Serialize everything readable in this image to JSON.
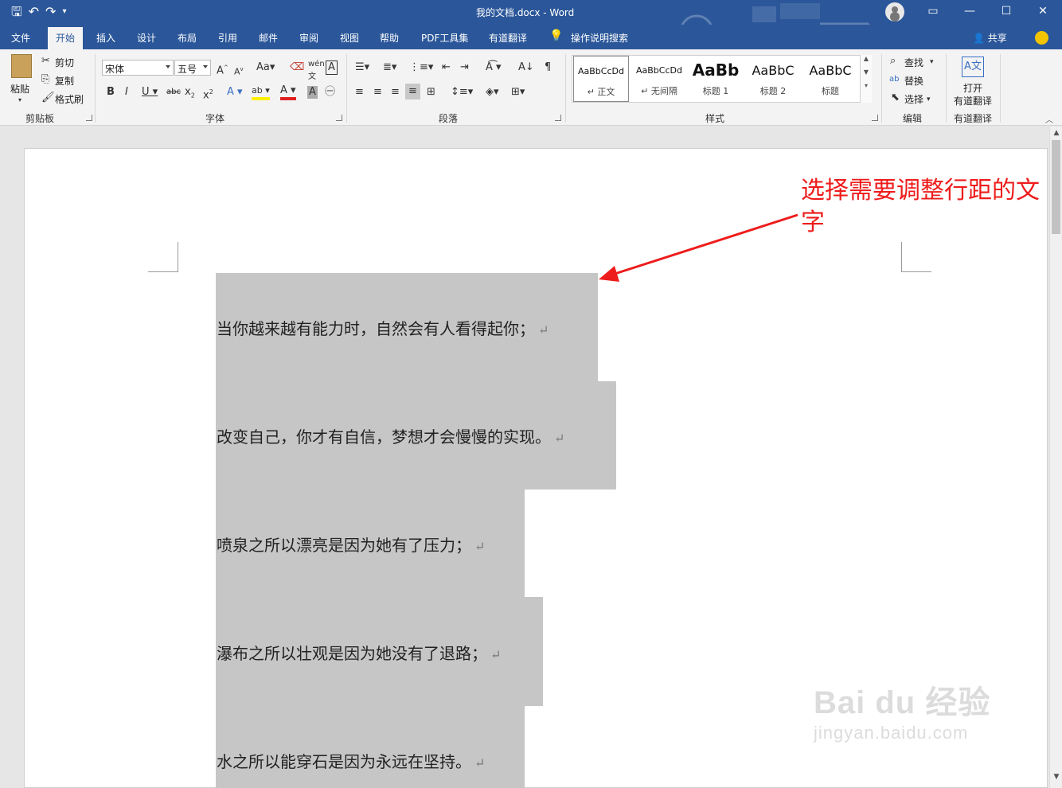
{
  "window": {
    "title": "我的文档.docx  -  Word",
    "controls": [
      "ribbon-display",
      "minimize",
      "maximize",
      "close"
    ]
  },
  "tabs": [
    "文件",
    "开始",
    "插入",
    "设计",
    "布局",
    "引用",
    "邮件",
    "审阅",
    "视图",
    "帮助",
    "PDF工具集",
    "有道翻译"
  ],
  "active_tab": "开始",
  "tell_me": "操作说明搜索",
  "share": "共享",
  "ribbon": {
    "clipboard": {
      "label": "剪贴板",
      "paste": "粘贴",
      "cut": "剪切",
      "copy": "复制",
      "format_painter": "格式刷"
    },
    "font": {
      "label": "字体",
      "font_name": "宋体",
      "font_size": "五号"
    },
    "paragraph": {
      "label": "段落"
    },
    "styles": {
      "label": "样式",
      "items": [
        {
          "sample": "AaBbCcDd",
          "name": "↵ 正文"
        },
        {
          "sample": "AaBbCcDd",
          "name": "↵ 无间隔"
        },
        {
          "sample": "AaBb",
          "name": "标题 1"
        },
        {
          "sample": "AaBbC",
          "name": "标题 2"
        },
        {
          "sample": "AaBbC",
          "name": "标题"
        }
      ]
    },
    "editing": {
      "label": "编辑",
      "find": "查找",
      "replace": "替换",
      "select": "选择"
    },
    "youdao": {
      "label": "有道翻译",
      "open_line1": "打开",
      "open_line2": "有道翻译"
    }
  },
  "document": {
    "lines": [
      "当你越来越有能力时，自然会有人看得起你；",
      "改变自己，你才有自信，梦想才会慢慢的实现。",
      "喷泉之所以漂亮是因为她有了压力；",
      "瀑布之所以壮观是因为她没有了退路；",
      "水之所以能穿石是因为永远在坚持。"
    ],
    "paragraph_mark": "↵"
  },
  "annotation": {
    "text": "选择需要调整行距的文字",
    "color": "#ee1c1c"
  },
  "watermark": {
    "brand": "Bai du 经验",
    "url": "jingyan.baidu.com"
  },
  "colors": {
    "titlebar": "#2b579a",
    "selection": "#c6c6c6"
  }
}
